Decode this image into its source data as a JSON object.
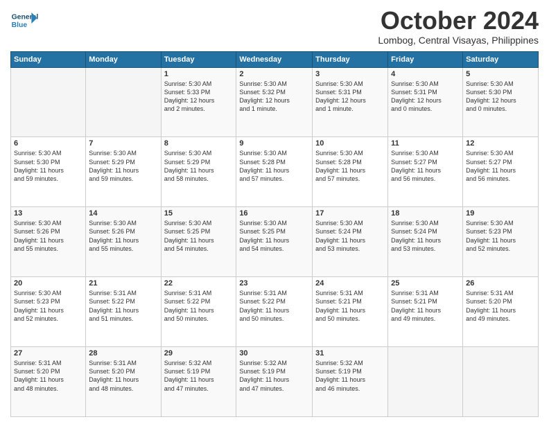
{
  "logo": {
    "general": "General",
    "blue": "Blue"
  },
  "header": {
    "month": "October 2024",
    "location": "Lombog, Central Visayas, Philippines"
  },
  "weekdays": [
    "Sunday",
    "Monday",
    "Tuesday",
    "Wednesday",
    "Thursday",
    "Friday",
    "Saturday"
  ],
  "weeks": [
    [
      {
        "day": "",
        "info": ""
      },
      {
        "day": "",
        "info": ""
      },
      {
        "day": "1",
        "info": "Sunrise: 5:30 AM\nSunset: 5:33 PM\nDaylight: 12 hours\nand 2 minutes."
      },
      {
        "day": "2",
        "info": "Sunrise: 5:30 AM\nSunset: 5:32 PM\nDaylight: 12 hours\nand 1 minute."
      },
      {
        "day": "3",
        "info": "Sunrise: 5:30 AM\nSunset: 5:31 PM\nDaylight: 12 hours\nand 1 minute."
      },
      {
        "day": "4",
        "info": "Sunrise: 5:30 AM\nSunset: 5:31 PM\nDaylight: 12 hours\nand 0 minutes."
      },
      {
        "day": "5",
        "info": "Sunrise: 5:30 AM\nSunset: 5:30 PM\nDaylight: 12 hours\nand 0 minutes."
      }
    ],
    [
      {
        "day": "6",
        "info": "Sunrise: 5:30 AM\nSunset: 5:30 PM\nDaylight: 11 hours\nand 59 minutes."
      },
      {
        "day": "7",
        "info": "Sunrise: 5:30 AM\nSunset: 5:29 PM\nDaylight: 11 hours\nand 59 minutes."
      },
      {
        "day": "8",
        "info": "Sunrise: 5:30 AM\nSunset: 5:29 PM\nDaylight: 11 hours\nand 58 minutes."
      },
      {
        "day": "9",
        "info": "Sunrise: 5:30 AM\nSunset: 5:28 PM\nDaylight: 11 hours\nand 57 minutes."
      },
      {
        "day": "10",
        "info": "Sunrise: 5:30 AM\nSunset: 5:28 PM\nDaylight: 11 hours\nand 57 minutes."
      },
      {
        "day": "11",
        "info": "Sunrise: 5:30 AM\nSunset: 5:27 PM\nDaylight: 11 hours\nand 56 minutes."
      },
      {
        "day": "12",
        "info": "Sunrise: 5:30 AM\nSunset: 5:27 PM\nDaylight: 11 hours\nand 56 minutes."
      }
    ],
    [
      {
        "day": "13",
        "info": "Sunrise: 5:30 AM\nSunset: 5:26 PM\nDaylight: 11 hours\nand 55 minutes."
      },
      {
        "day": "14",
        "info": "Sunrise: 5:30 AM\nSunset: 5:26 PM\nDaylight: 11 hours\nand 55 minutes."
      },
      {
        "day": "15",
        "info": "Sunrise: 5:30 AM\nSunset: 5:25 PM\nDaylight: 11 hours\nand 54 minutes."
      },
      {
        "day": "16",
        "info": "Sunrise: 5:30 AM\nSunset: 5:25 PM\nDaylight: 11 hours\nand 54 minutes."
      },
      {
        "day": "17",
        "info": "Sunrise: 5:30 AM\nSunset: 5:24 PM\nDaylight: 11 hours\nand 53 minutes."
      },
      {
        "day": "18",
        "info": "Sunrise: 5:30 AM\nSunset: 5:24 PM\nDaylight: 11 hours\nand 53 minutes."
      },
      {
        "day": "19",
        "info": "Sunrise: 5:30 AM\nSunset: 5:23 PM\nDaylight: 11 hours\nand 52 minutes."
      }
    ],
    [
      {
        "day": "20",
        "info": "Sunrise: 5:30 AM\nSunset: 5:23 PM\nDaylight: 11 hours\nand 52 minutes."
      },
      {
        "day": "21",
        "info": "Sunrise: 5:31 AM\nSunset: 5:22 PM\nDaylight: 11 hours\nand 51 minutes."
      },
      {
        "day": "22",
        "info": "Sunrise: 5:31 AM\nSunset: 5:22 PM\nDaylight: 11 hours\nand 50 minutes."
      },
      {
        "day": "23",
        "info": "Sunrise: 5:31 AM\nSunset: 5:22 PM\nDaylight: 11 hours\nand 50 minutes."
      },
      {
        "day": "24",
        "info": "Sunrise: 5:31 AM\nSunset: 5:21 PM\nDaylight: 11 hours\nand 50 minutes."
      },
      {
        "day": "25",
        "info": "Sunrise: 5:31 AM\nSunset: 5:21 PM\nDaylight: 11 hours\nand 49 minutes."
      },
      {
        "day": "26",
        "info": "Sunrise: 5:31 AM\nSunset: 5:20 PM\nDaylight: 11 hours\nand 49 minutes."
      }
    ],
    [
      {
        "day": "27",
        "info": "Sunrise: 5:31 AM\nSunset: 5:20 PM\nDaylight: 11 hours\nand 48 minutes."
      },
      {
        "day": "28",
        "info": "Sunrise: 5:31 AM\nSunset: 5:20 PM\nDaylight: 11 hours\nand 48 minutes."
      },
      {
        "day": "29",
        "info": "Sunrise: 5:32 AM\nSunset: 5:19 PM\nDaylight: 11 hours\nand 47 minutes."
      },
      {
        "day": "30",
        "info": "Sunrise: 5:32 AM\nSunset: 5:19 PM\nDaylight: 11 hours\nand 47 minutes."
      },
      {
        "day": "31",
        "info": "Sunrise: 5:32 AM\nSunset: 5:19 PM\nDaylight: 11 hours\nand 46 minutes."
      },
      {
        "day": "",
        "info": ""
      },
      {
        "day": "",
        "info": ""
      }
    ]
  ]
}
